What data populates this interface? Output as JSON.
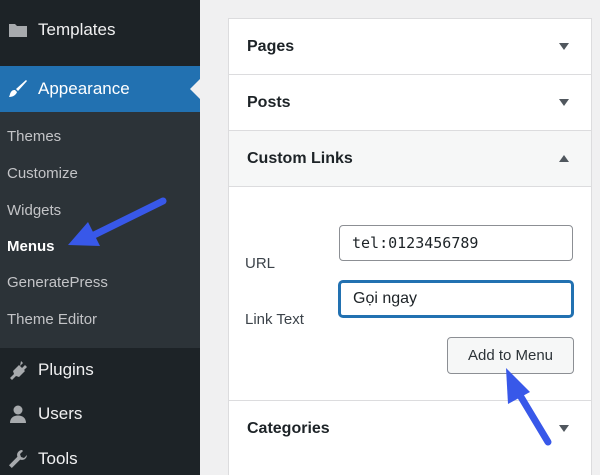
{
  "sidebar": {
    "templates": {
      "label": "Templates",
      "icon": "folder-icon"
    },
    "appearance": {
      "label": "Appearance",
      "icon": "paintbrush-icon"
    },
    "submenu": [
      "Themes",
      "Customize",
      "Widgets",
      "Menus",
      "GeneratePress",
      "Theme Editor"
    ],
    "current_submenu": "Menus",
    "plugins": {
      "label": "Plugins",
      "icon": "plug-icon"
    },
    "users": {
      "label": "Users",
      "icon": "user-icon"
    },
    "tools": {
      "label": "Tools",
      "icon": "wrench-icon"
    }
  },
  "panel": {
    "pages": "Pages",
    "posts": "Posts",
    "custom_links": "Custom Links",
    "url_label": "URL",
    "url_value": "tel:0123456789",
    "link_text_label": "Link Text",
    "link_text_value": "Gọi ngay",
    "add_button": "Add to Menu",
    "categories": "Categories"
  },
  "colors": {
    "sidebar_bg": "#1d2327",
    "submenu_bg": "#2c3338",
    "active_bg": "#2271b1",
    "arrow": "#3858e9"
  }
}
